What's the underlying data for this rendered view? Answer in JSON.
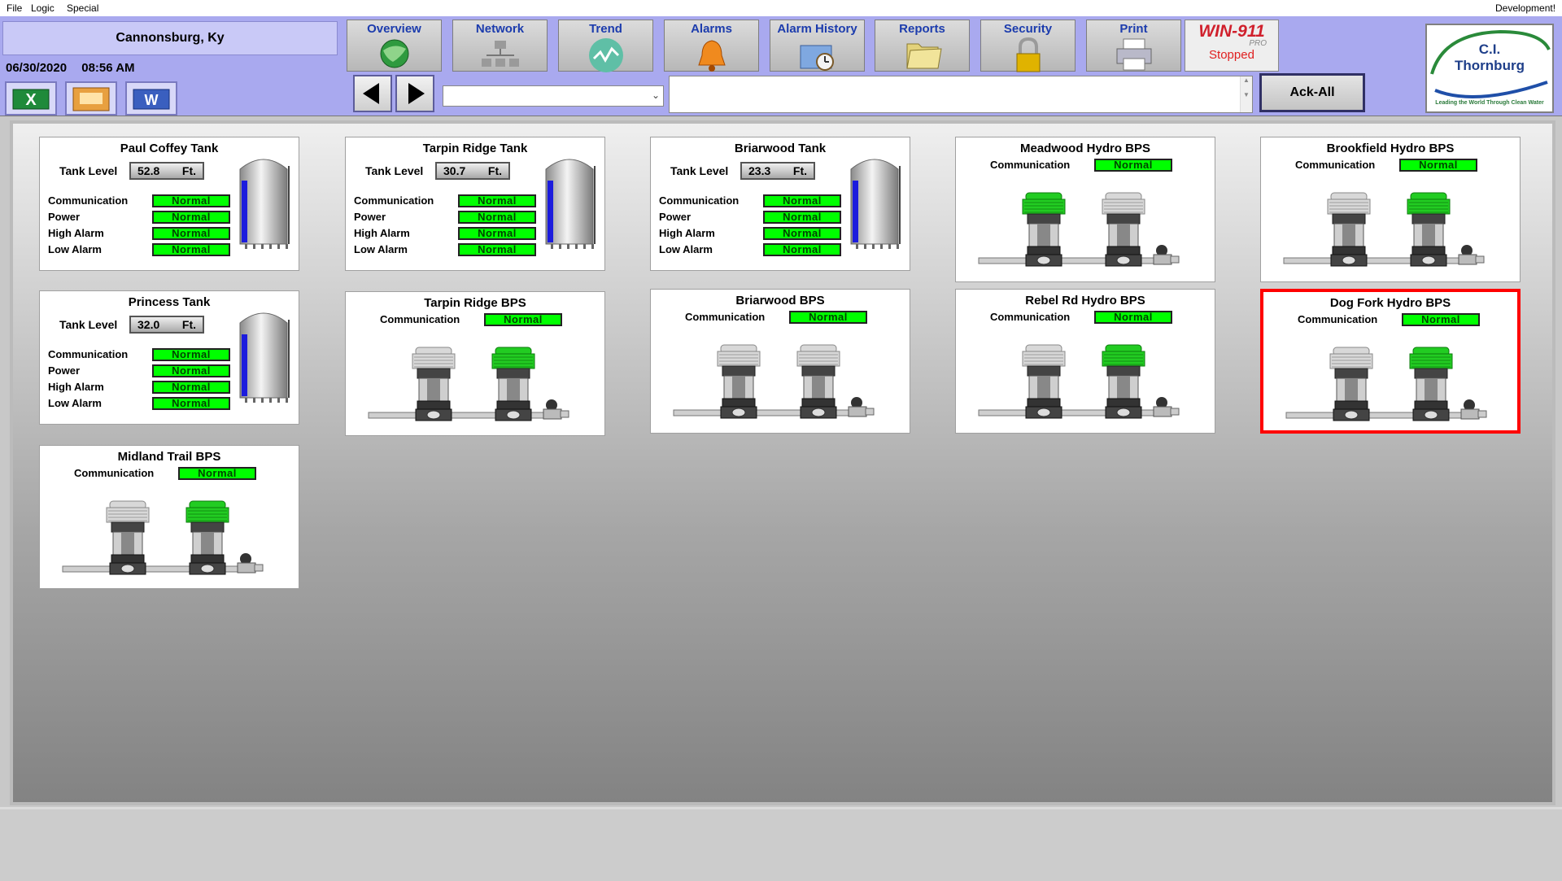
{
  "menu": {
    "file": "File",
    "logic": "Logic",
    "special": "Special",
    "right_label": "Development!"
  },
  "header": {
    "location": "Cannonsburg, Ky",
    "date": "06/30/2020",
    "time": "08:56 AM",
    "export_icons": [
      "excel-icon",
      "presentation-icon",
      "word-icon"
    ]
  },
  "nav": [
    {
      "label": "Overview",
      "icon": "globe-icon"
    },
    {
      "label": "Network",
      "icon": "network-icon"
    },
    {
      "label": "Trend",
      "icon": "trend-icon"
    },
    {
      "label": "Alarms",
      "icon": "bell-icon"
    },
    {
      "label": "Alarm History",
      "icon": "clock-folder-icon"
    },
    {
      "label": "Reports",
      "icon": "folder-icon"
    },
    {
      "label": "Security",
      "icon": "lock-icon"
    },
    {
      "label": "Print",
      "icon": "printer-icon"
    }
  ],
  "win911": {
    "brand": "WIN-911",
    "edition": "PRO",
    "status": "Stopped"
  },
  "toolbar": {
    "dropdown_value": "",
    "alarm_text": "",
    "ack_label": "Ack-All"
  },
  "logo": {
    "line1": "C.I.",
    "line2": "Thornburg",
    "tagline": "Leading the World Through Clean Water"
  },
  "labels": {
    "tank_level": "Tank Level",
    "communication": "Communication",
    "power": "Power",
    "high_alarm": "High Alarm",
    "low_alarm": "Low Alarm",
    "unit": "Ft."
  },
  "tanks": [
    {
      "name": "Paul Coffey Tank",
      "level": "52.8",
      "communication": "Normal",
      "power": "Normal",
      "high_alarm": "Normal",
      "low_alarm": "Normal"
    },
    {
      "name": "Tarpin Ridge Tank",
      "level": "30.7",
      "communication": "Normal",
      "power": "Normal",
      "high_alarm": "Normal",
      "low_alarm": "Normal"
    },
    {
      "name": "Briarwood Tank",
      "level": "23.3",
      "communication": "Normal",
      "power": "Normal",
      "high_alarm": "Normal",
      "low_alarm": "Normal"
    },
    {
      "name": "Princess Tank",
      "level": "32.0",
      "communication": "Normal",
      "power": "Normal",
      "high_alarm": "Normal",
      "low_alarm": "Normal"
    }
  ],
  "stations": [
    {
      "name": "Meadwood Hydro BPS",
      "communication": "Normal",
      "pumps": [
        "running",
        "off"
      ],
      "in_alarm": false
    },
    {
      "name": "Brookfield Hydro BPS",
      "communication": "Normal",
      "pumps": [
        "off",
        "running"
      ],
      "in_alarm": false
    },
    {
      "name": "Tarpin Ridge BPS",
      "communication": "Normal",
      "pumps": [
        "off",
        "running"
      ],
      "in_alarm": false
    },
    {
      "name": "Briarwood BPS",
      "communication": "Normal",
      "pumps": [
        "off",
        "off"
      ],
      "in_alarm": false
    },
    {
      "name": "Rebel Rd Hydro BPS",
      "communication": "Normal",
      "pumps": [
        "off",
        "running"
      ],
      "in_alarm": false
    },
    {
      "name": "Dog Fork Hydro BPS",
      "communication": "Normal",
      "pumps": [
        "off",
        "running"
      ],
      "in_alarm": true
    },
    {
      "name": "Midland Trail  BPS",
      "communication": "Normal",
      "pumps": [
        "off",
        "running"
      ],
      "in_alarm": false
    }
  ],
  "colors": {
    "normal": "#00ff00",
    "alarm_border": "#ff0000",
    "pump_running": "#22cc22",
    "pump_off": "#d8d8d8",
    "tank_fill": "#2020ff"
  }
}
